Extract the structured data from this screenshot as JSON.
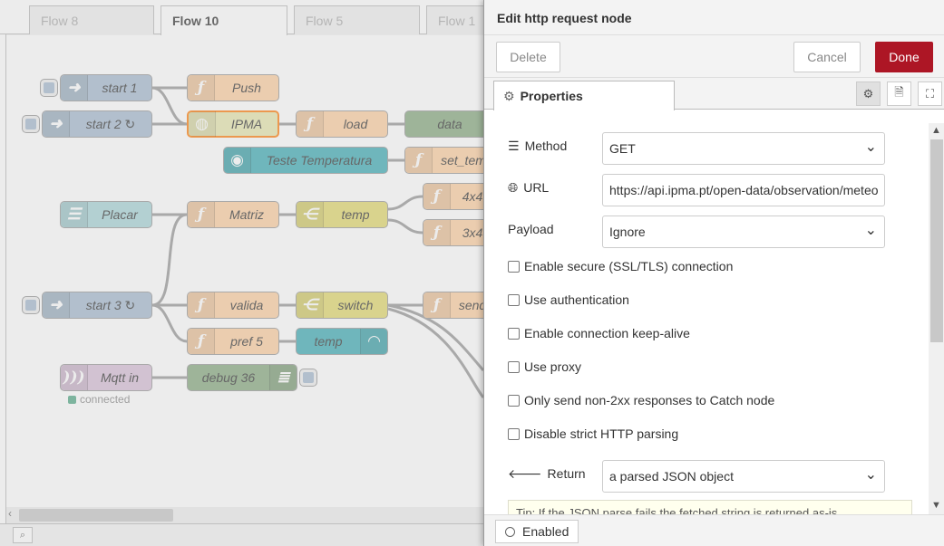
{
  "workspace": {
    "tabs": [
      "Flow 8",
      "Flow 10",
      "Flow 5",
      "Flow 1"
    ],
    "active_tab": "Flow 10",
    "nodes": {
      "start1": "start 1",
      "push": "Push",
      "start2": "start 2 ↻",
      "ipma": "IPMA",
      "load": "load",
      "data": "data",
      "teste": "Teste Temperatura",
      "set_tem": "set_tem",
      "four": "4x4",
      "three": "3x4",
      "placar": "Placar",
      "matriz": "Matriz",
      "temp": "temp",
      "start3": "start 3 ↻",
      "valida": "valida",
      "switch": "switch",
      "send": "send",
      "pref5": "pref 5",
      "temp_gauge": "temp",
      "mqtt": "Mqtt in",
      "debug": "debug 36"
    },
    "mqtt_status": "connected",
    "colors": {
      "inject": "#a6bbcf",
      "function": "#fdd0a2",
      "http": "#e7e7ae",
      "switch": "#e2d96e",
      "dashboard": "#3fadb5",
      "debug": "#87a980",
      "mqtt": "#d8bfd8"
    }
  },
  "tray": {
    "title": "Edit http request node",
    "delete_label": "Delete",
    "cancel_label": "Cancel",
    "done_label": "Done",
    "tab_label": "Properties",
    "method": {
      "label": "Method",
      "value": "GET"
    },
    "url": {
      "label": "URL",
      "value": "https://api.ipma.pt/open-data/observation/meteo"
    },
    "payload": {
      "label": "Payload",
      "value": "Ignore"
    },
    "checkboxes": [
      "Enable secure (SSL/TLS) connection",
      "Use authentication",
      "Enable connection keep-alive",
      "Use proxy",
      "Only send non-2xx responses to Catch node",
      "Disable strict HTTP parsing"
    ],
    "return": {
      "label": "Return",
      "value": "a parsed JSON object"
    },
    "tip": "Tip: If the JSON parse fails the fetched string is returned as-is.",
    "enabled_label": "Enabled",
    "accent": "#ad1625"
  }
}
